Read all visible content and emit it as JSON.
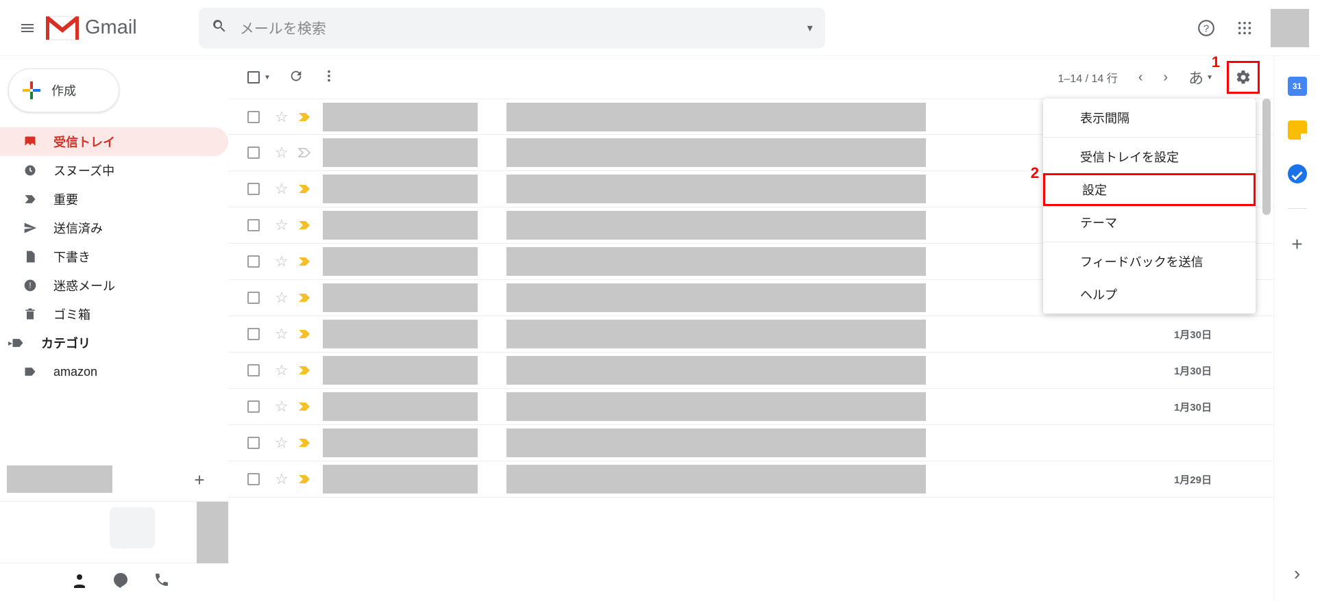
{
  "header": {
    "logo_text": "Gmail",
    "search_placeholder": "メールを検索"
  },
  "compose_label": "作成",
  "sidebar_items": [
    {
      "label": "受信トレイ",
      "icon": "inbox",
      "active": true,
      "bold": true
    },
    {
      "label": "スヌーズ中",
      "icon": "clock",
      "active": false,
      "bold": false
    },
    {
      "label": "重要",
      "icon": "important",
      "active": false,
      "bold": false
    },
    {
      "label": "送信済み",
      "icon": "send",
      "active": false,
      "bold": false
    },
    {
      "label": "下書き",
      "icon": "draft",
      "active": false,
      "bold": false
    },
    {
      "label": "迷惑メール",
      "icon": "spam",
      "active": false,
      "bold": false
    },
    {
      "label": "ゴミ箱",
      "icon": "trash",
      "active": false,
      "bold": false
    },
    {
      "label": "カテゴリ",
      "icon": "label",
      "active": false,
      "bold": true,
      "expandable": true
    },
    {
      "label": "amazon",
      "icon": "label",
      "active": false,
      "bold": false
    }
  ],
  "toolbar": {
    "page_count": "1–14 / 14 行",
    "lang_indicator": "あ"
  },
  "mail_rows": [
    {
      "important": "yellow",
      "date": ""
    },
    {
      "important": "gray",
      "date": ""
    },
    {
      "important": "yellow",
      "date": ""
    },
    {
      "important": "yellow",
      "date": ""
    },
    {
      "important": "yellow",
      "date": ""
    },
    {
      "important": "yellow",
      "date": ""
    },
    {
      "important": "yellow",
      "date": "1月30日"
    },
    {
      "important": "yellow",
      "date": "1月30日"
    },
    {
      "important": "yellow",
      "date": "1月30日"
    },
    {
      "important": "yellow",
      "date": ""
    },
    {
      "important": "yellow",
      "date": "1月29日"
    }
  ],
  "settings_menu": {
    "group1": [
      "表示間隔"
    ],
    "group2": [
      "受信トレイを設定",
      "設定",
      "テーマ"
    ],
    "group3": [
      "フィードバックを送信",
      "ヘルプ"
    ],
    "highlight_index": 1
  },
  "rightbar": {
    "calendar_day": "31"
  },
  "annotations": {
    "label1": "1",
    "label2": "2"
  }
}
